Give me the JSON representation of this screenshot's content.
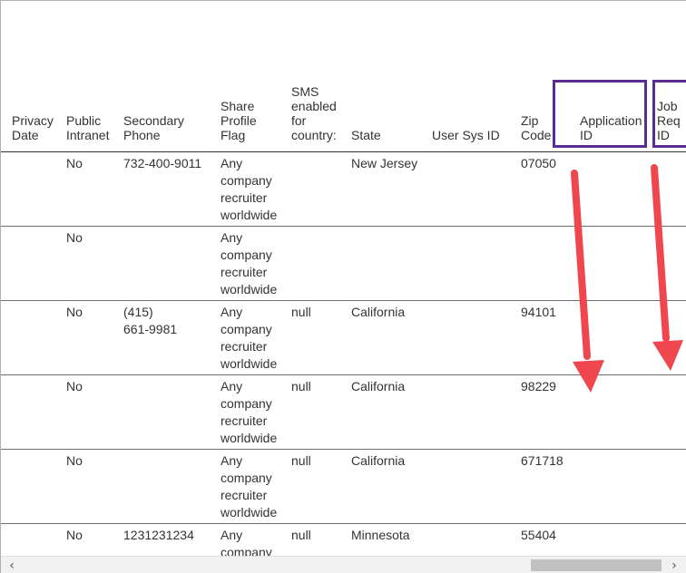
{
  "table": {
    "columns": [
      {
        "key": "privacy_date",
        "lines": [
          "Privacy",
          "Date"
        ]
      },
      {
        "key": "public_intranet",
        "lines": [
          "Public",
          "Intranet"
        ]
      },
      {
        "key": "secondary_phone",
        "lines": [
          "Secondary",
          "Phone"
        ]
      },
      {
        "key": "share_profile_flag",
        "lines": [
          "Share",
          "Profile",
          "Flag"
        ]
      },
      {
        "key": "sms_enabled",
        "lines": [
          "SMS",
          "enabled",
          "for",
          "country:"
        ]
      },
      {
        "key": "state",
        "lines": [
          "State"
        ]
      },
      {
        "key": "user_sys_id",
        "lines": [
          "User Sys ID"
        ]
      },
      {
        "key": "zip_code",
        "lines": [
          "Zip",
          "Code"
        ]
      },
      {
        "key": "application_id",
        "lines": [
          "Application",
          "ID"
        ]
      },
      {
        "key": "job_req_id",
        "lines": [
          "Job",
          "Req",
          "ID"
        ]
      }
    ],
    "rows": [
      {
        "public_intranet": "No",
        "secondary_phone": [
          "732-400-9011"
        ],
        "share_profile_flag": [
          "Any",
          "company",
          "recruiter",
          "worldwide"
        ],
        "sms_enabled": "",
        "state": "New Jersey",
        "zip_code": "07050"
      },
      {
        "public_intranet": "No",
        "secondary_phone": [],
        "share_profile_flag": [
          "Any",
          "company",
          "recruiter",
          "worldwide"
        ],
        "sms_enabled": "",
        "state": "",
        "zip_code": ""
      },
      {
        "public_intranet": "No",
        "secondary_phone": [
          "(415)",
          "661-9981"
        ],
        "share_profile_flag": [
          "Any",
          "company",
          "recruiter",
          "worldwide"
        ],
        "sms_enabled": "null",
        "state": "California",
        "zip_code": "94101"
      },
      {
        "public_intranet": "No",
        "secondary_phone": [],
        "share_profile_flag": [
          "Any",
          "company",
          "recruiter",
          "worldwide"
        ],
        "sms_enabled": "null",
        "state": "California",
        "zip_code": "98229"
      },
      {
        "public_intranet": "No",
        "secondary_phone": [],
        "share_profile_flag": [
          "Any",
          "company",
          "recruiter",
          "worldwide"
        ],
        "sms_enabled": "null",
        "state": "California",
        "zip_code": "671718"
      },
      {
        "public_intranet": "No",
        "secondary_phone": [
          "1231231234"
        ],
        "share_profile_flag": [
          "Any",
          "company"
        ],
        "sms_enabled": "null",
        "state": "Minnesota",
        "zip_code": "55404"
      }
    ]
  },
  "annotations": {
    "box_color": "#5b2c91",
    "arrow_color": "#f0474f",
    "highlighted_columns": [
      "Application ID",
      "Job Req ID"
    ]
  },
  "scrollbar": {
    "left_arrow": "‹",
    "right_arrow": "›"
  }
}
